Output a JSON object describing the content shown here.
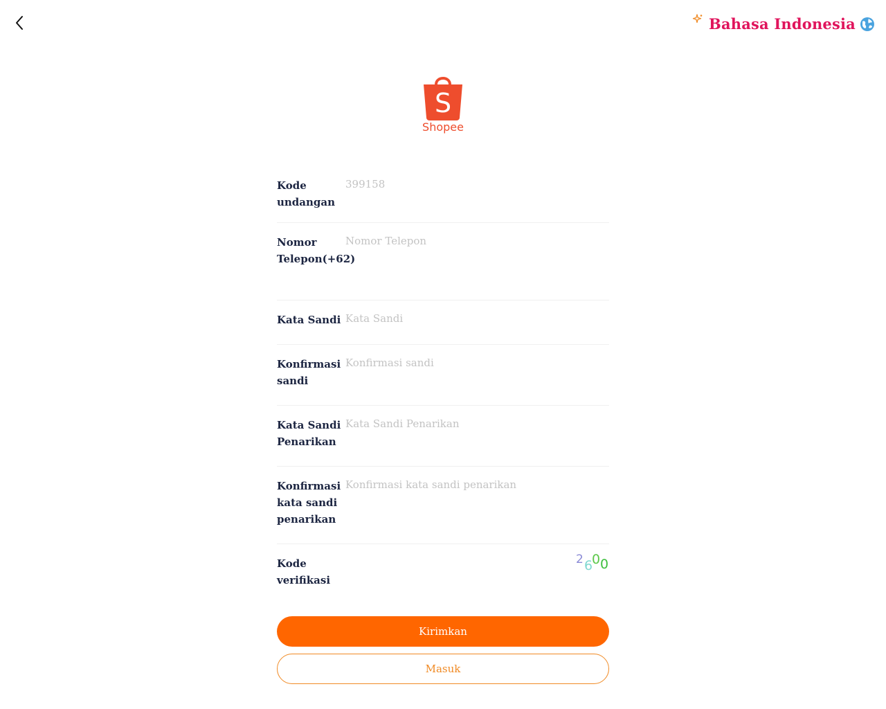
{
  "header": {
    "back_icon": "chevron-left-icon",
    "language_label": "Bahasa Indonesia",
    "language_icon": "globe-icon",
    "accent_color": "#e0145c"
  },
  "brand": {
    "name": "Shopee",
    "color": "#ee4d2d",
    "logo_letter": "S"
  },
  "form": {
    "invite": {
      "label": "Kode undangan",
      "value": "399158"
    },
    "phone": {
      "label": "Nomor Telepon(+62)",
      "placeholder": "Nomor Telepon"
    },
    "password": {
      "label": "Kata Sandi",
      "placeholder": "Kata Sandi"
    },
    "confirm_password": {
      "label": "Konfirmasi sandi",
      "placeholder": "Konfirmasi sandi"
    },
    "withdraw_password": {
      "label": "Kata Sandi Penarikan",
      "placeholder": "Kata Sandi Penarikan"
    },
    "confirm_withdraw_password": {
      "label": "Konfirmasi kata sandi penarikan",
      "placeholder": "Konfirmasi kata sandi penarikan"
    },
    "verification": {
      "label": "Kode verifikasi",
      "captcha_chars": [
        "2",
        "6",
        "0",
        "0"
      ],
      "captcha_colors": [
        "#8a8ad6",
        "#7fd8d0",
        "#5cc84a",
        "#3fbf3f"
      ]
    }
  },
  "actions": {
    "submit_label": "Kirimkan",
    "login_label": "Masuk",
    "primary_color": "#ff6600",
    "secondary_color": "#f08a24"
  }
}
